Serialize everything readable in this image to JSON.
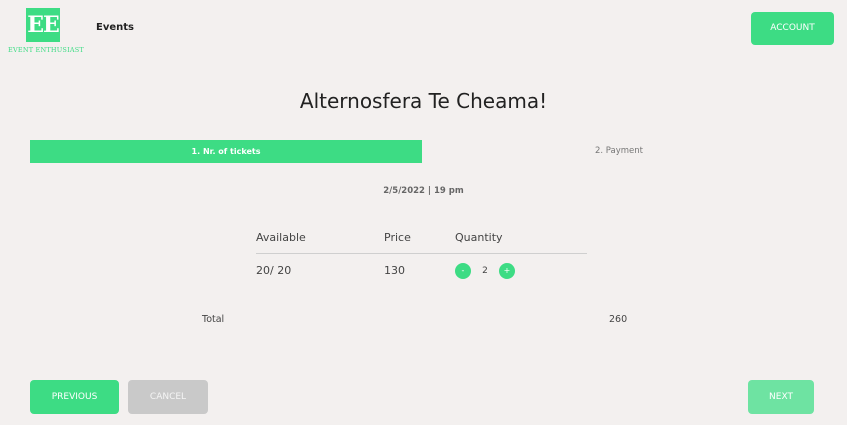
{
  "header": {
    "logo_mark": "EE",
    "logo_text": "EVENT ENTHUSIAST",
    "nav_events": "Events",
    "account_label": "ACCOUNT"
  },
  "event": {
    "title": "Alternosfera Te Cheama!",
    "date": "2/5/2022 | 19 pm"
  },
  "steps": [
    {
      "label": "1. Nr. of tickets",
      "active": true
    },
    {
      "label": "2. Payment",
      "active": false
    }
  ],
  "tickets": {
    "headers": [
      "Available",
      "Price",
      "Quantity"
    ],
    "row": {
      "available": "20/ 20",
      "price": "130",
      "quantity": "2",
      "decrement_label": "-",
      "increment_label": "+"
    }
  },
  "total": {
    "label": "Total",
    "value": "260"
  },
  "footer": {
    "previous_label": "PREVIOUS",
    "cancel_label": "CANCEL",
    "next_label": "NEXT"
  },
  "colors": {
    "accent": "#3ddc84",
    "next_button": "#6ee3a2",
    "cancel_button": "#c9c9c9",
    "background": "#f3f0ef"
  },
  "icons": [
    "event-enthusiast-logo"
  ]
}
